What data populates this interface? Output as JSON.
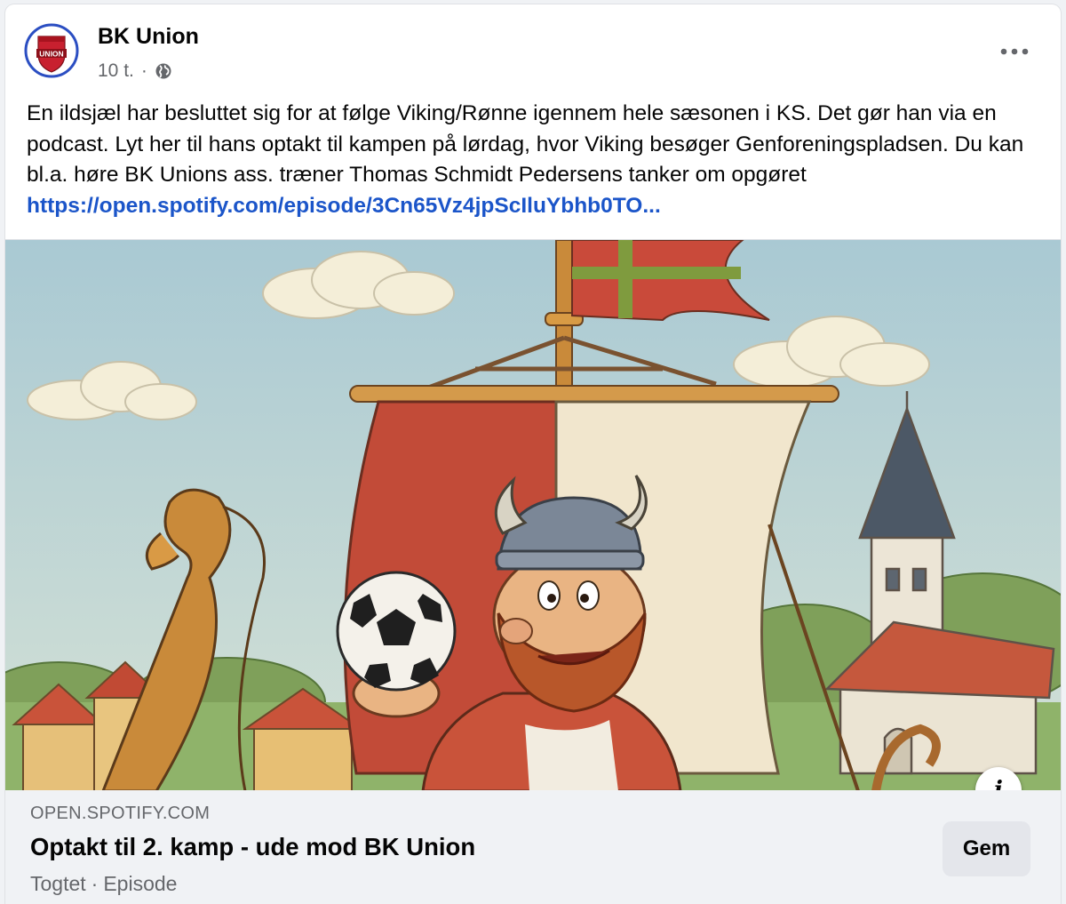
{
  "post": {
    "page_name": "BK Union",
    "time": "10 t.",
    "separator": "·",
    "privacy_icon": "globe-icon",
    "more_icon": "more-horizontal-icon",
    "text": "En ildsjæl har besluttet sig for at følge Viking/Rønne igennem hele sæsonen i KS. Det gør han via en podcast. Lyt her til hans optakt til kampen på lørdag, hvor Viking besøger Genforeningspladsen. Du kan bl.a. høre BK Unions ass. træner Thomas Schmidt Pedersens tanker om opgøret",
    "link_text": "https://open.spotify.com/episode/3Cn65Vz4jpScIluYbhb0TO..."
  },
  "logo": {
    "text": "UNION",
    "ring_color": "#2b4ec2",
    "shield_color": "#c8202f"
  },
  "media": {
    "info_label": "i"
  },
  "link_preview": {
    "domain": "OPEN.SPOTIFY.COM",
    "title": "Optakt til 2. kamp - ude mod BK Union",
    "subtitle_source": "Togtet",
    "subtitle_separator": "·",
    "subtitle_type": "Episode",
    "save_label": "Gem"
  },
  "colors": {
    "link": "#1b55c9",
    "secondary_text": "#65676b",
    "button_bg": "#e4e6eb",
    "preview_bg": "#f0f2f5"
  }
}
